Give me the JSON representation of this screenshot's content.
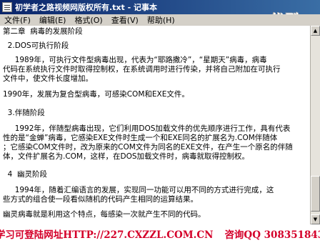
{
  "window": {
    "title": "初学者之路视频网版权所有.txt - 记事本",
    "logo_text": "优酷"
  },
  "menubar": {
    "items": [
      "文件(F)",
      "编辑(E)",
      "格式(O)",
      "查看(V)",
      "帮助(H)"
    ]
  },
  "document": {
    "lines": [
      "第二章  病毒的发展阶段",
      "  2.DOS可执行阶段",
      "     1989年，可执行文件型病毒出现，代表为“耶路撒冷”，“星期天”病毒，病毒",
      "代码在系统执行文件时取得控制权，在系统调用时进行传染，并将自己附加在可执行",
      "文件中，使文件长度增加。",
      "1990年，发展为复合型病毒，可感染COM和EXE文件。",
      "  3.伴随阶段",
      "     1992年，伴随型病毒出现，它们利用DOS加载文件的优先顺序进行工作，具有代表",
      "性的是“金蝉”病毒，它感染EXE文件时生成一个和EXE同名的扩展名为.COM伴随体",
      "；它感染COM文件时，改为原来的COM文件为同名的EXE文件，在产生一个原名的伴随",
      "体，文件扩展名为.COM，这样，在DOS加载文件时，病毒就取得控制权。",
      "  4  幽灵阶段",
      "     1994年，随着汇编语言的发展，实现同一功能可以用不同的方式进行完成，这",
      "些方式的组合使一段看似随机的代码产生相同的运算结果。",
      "幽灵病毒就是利用这个特点，每感染一次就产生不同的代码。"
    ]
  },
  "banner": {
    "left": "学习可登陆网址HTTP://227.CXZZL.COM.CN",
    "right": "咨询QQ 308351843",
    "color": "#d4002a"
  }
}
